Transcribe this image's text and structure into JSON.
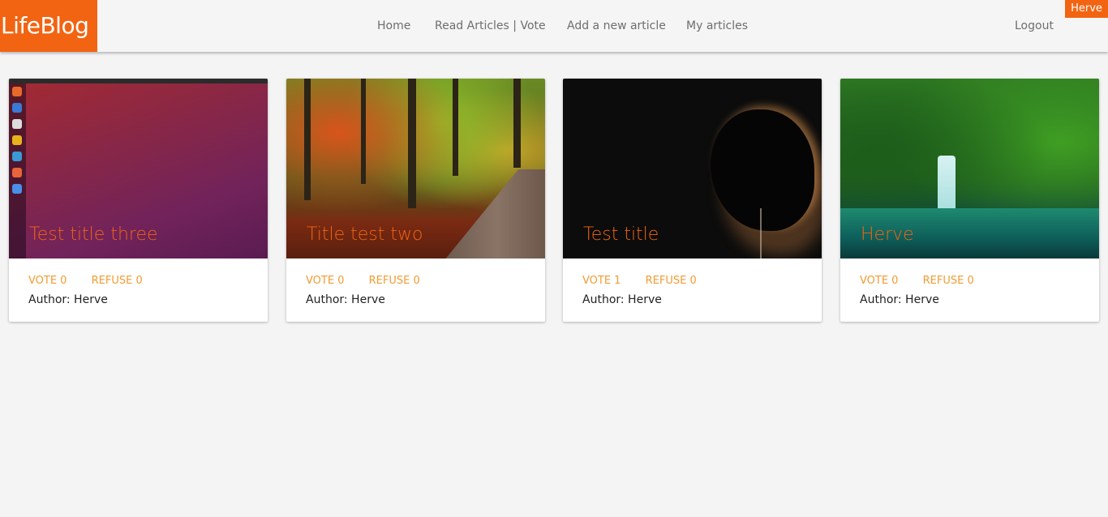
{
  "brand": {
    "logo": "LifeBlog",
    "accent": "#f26412"
  },
  "nav": {
    "home": "Home",
    "read": "Read Articles | Vote",
    "add": "Add a new article",
    "mine": "My articles",
    "logout": "Logout"
  },
  "user": {
    "name": "Herve"
  },
  "articles": [
    {
      "title": "Test title three",
      "vote": "VOTE 0",
      "refuse": "REFUSE 0",
      "author": "Author: Herve"
    },
    {
      "title": "Title test two",
      "vote": "VOTE 0",
      "refuse": "REFUSE 0",
      "author": "Author: Herve"
    },
    {
      "title": "Test title",
      "vote": "VOTE 1",
      "refuse": "REFUSE 0",
      "author": "Author: Herve"
    },
    {
      "title": "Herve",
      "vote": "VOTE 0",
      "refuse": "REFUSE 0",
      "author": "Author: Herve"
    }
  ]
}
